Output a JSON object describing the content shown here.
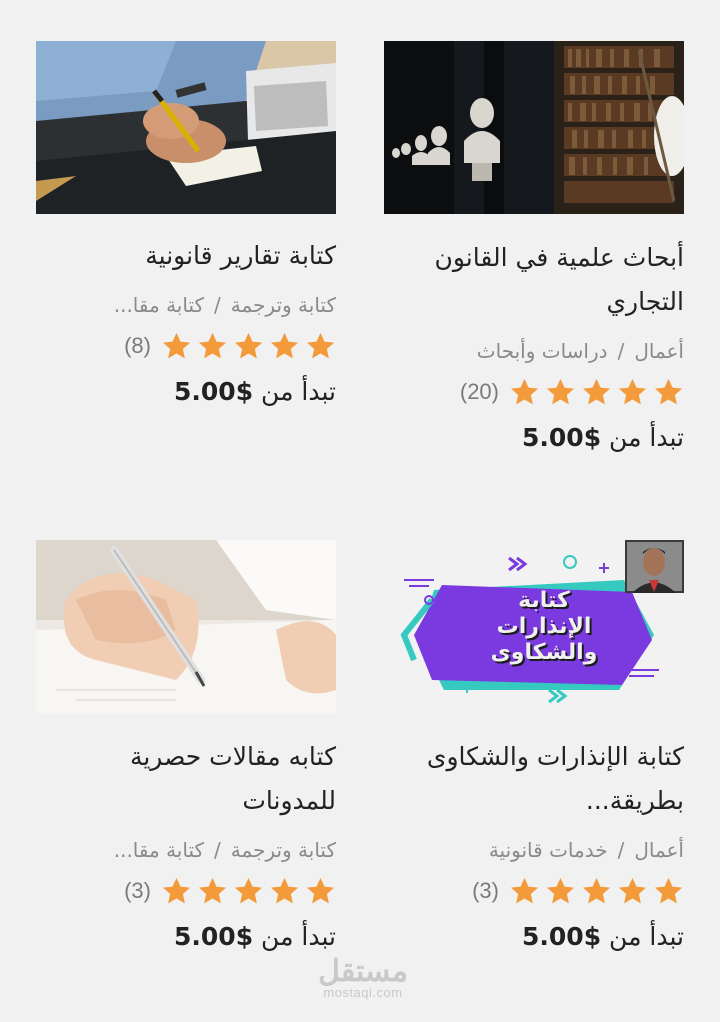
{
  "cards": [
    {
      "title": "أبحاث علمية في القانون التجاري",
      "category_main": "أعمال",
      "category_sub": "دراسات وأبحاث",
      "separator": "/",
      "rating": 5,
      "reviews": "(20)",
      "price_prefix": "تبدأ من",
      "price": "$5.00",
      "image": "library-busts-photo"
    },
    {
      "title": "كتابة تقارير قانونية",
      "category_main": "كتابة وترجمة",
      "category_sub": "كتابة مقا...",
      "separator": "/",
      "rating": 5,
      "reviews": "(8)",
      "price_prefix": "تبدأ من",
      "price": "$5.00",
      "image": "person-writing-laptop-photo"
    },
    {
      "title": "كتابة الإنذارات والشكاوى بطريقة...",
      "category_main": "أعمال",
      "category_sub": "خدمات قانونية",
      "separator": "/",
      "rating": 5,
      "reviews": "(3)",
      "price_prefix": "تبدأ من",
      "price": "$5.00",
      "image": "warnings-complaints-banner",
      "banner_text": [
        "كتابة",
        "الإنذارات",
        "والشكاوى"
      ]
    },
    {
      "title": "كتابه مقالات حصرية للمدونات",
      "category_main": "كتابة وترجمة",
      "category_sub": "كتابة مقا...",
      "separator": "/",
      "rating": 5,
      "reviews": "(3)",
      "price_prefix": "تبدأ من",
      "price": "$5.00",
      "image": "hand-writing-pen-photo"
    }
  ],
  "watermark": {
    "ar": "مستقل",
    "en": "mostaqi.com"
  },
  "colors": {
    "star": "#f39a3b",
    "background": "#f1f1f1",
    "category": "#8a8a8a"
  }
}
